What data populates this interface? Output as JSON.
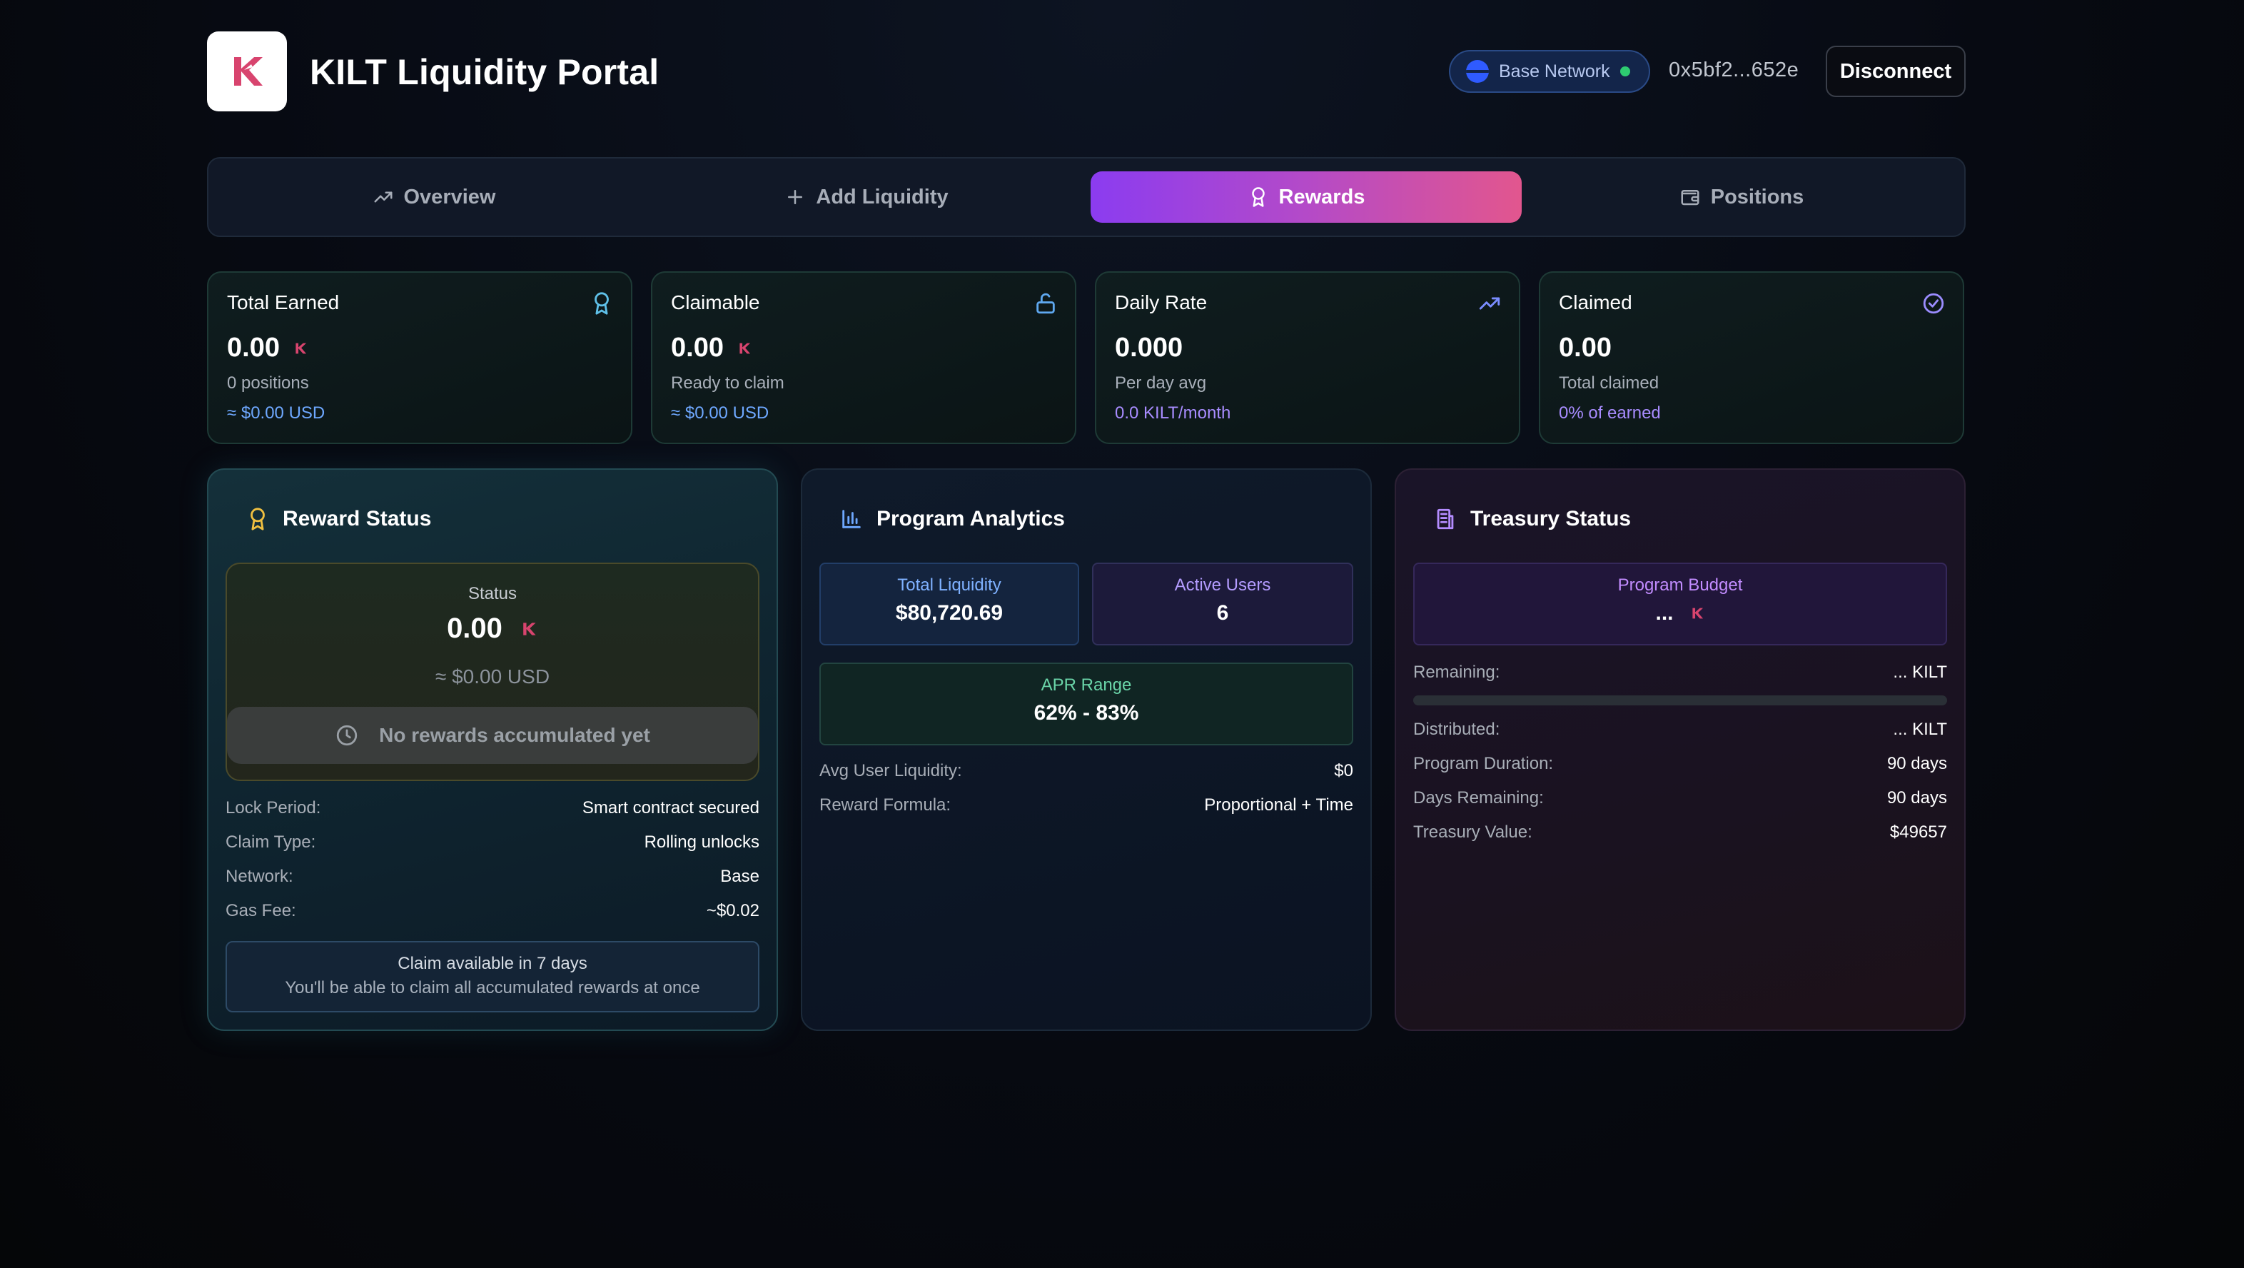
{
  "header": {
    "title": "KILT Liquidity Portal",
    "network_label": "Base Network",
    "wallet_address": "0x5bf2...652e",
    "disconnect_label": "Disconnect"
  },
  "tabs": [
    {
      "label": "Overview",
      "icon": "trending-up-icon",
      "active": false
    },
    {
      "label": "Add Liquidity",
      "icon": "plus-icon",
      "active": false
    },
    {
      "label": "Rewards",
      "icon": "award-icon",
      "active": true
    },
    {
      "label": "Positions",
      "icon": "wallet-icon",
      "active": false
    }
  ],
  "stats": [
    {
      "title": "Total Earned",
      "icon": "award-icon",
      "value": "0.00",
      "sub": "0 positions",
      "usd": "≈ $0.00 USD"
    },
    {
      "title": "Claimable",
      "icon": "unlock-icon",
      "value": "0.00",
      "sub": "Ready to claim",
      "usd": "≈ $0.00 USD"
    },
    {
      "title": "Daily Rate",
      "icon": "trending-up-icon",
      "value": "0.000",
      "sub": "Per day avg",
      "usd": "0.0 KILT/month"
    },
    {
      "title": "Claimed",
      "icon": "check-circle-icon",
      "value": "0.00",
      "sub": "Total claimed",
      "usd": "0% of earned"
    }
  ],
  "reward_status": {
    "title": "Reward Status",
    "status_label": "Status",
    "status_value": "0.00",
    "status_usd": "≈ $0.00 USD",
    "button_label": "No rewards accumulated yet",
    "rows": [
      {
        "k": "Lock Period:",
        "v": "Smart contract secured"
      },
      {
        "k": "Claim Type:",
        "v": "Rolling unlocks"
      },
      {
        "k": "Network:",
        "v": "Base"
      },
      {
        "k": "Gas Fee:",
        "v": "~$0.02"
      }
    ],
    "claim_note_title": "Claim available in 7 days",
    "claim_note_sub": "You'll be able to claim all accumulated rewards at once"
  },
  "analytics": {
    "title": "Program Analytics",
    "total_liquidity_label": "Total Liquidity",
    "total_liquidity_value": "$80,720.69",
    "active_users_label": "Active Users",
    "active_users_value": "6",
    "apr_label": "APR Range",
    "apr_value": "62% - 83%",
    "rows": [
      {
        "k": "Avg User Liquidity:",
        "v": "$0"
      },
      {
        "k": "Reward Formula:",
        "v": "Proportional + Time"
      }
    ]
  },
  "treasury": {
    "title": "Treasury Status",
    "budget_label": "Program Budget",
    "budget_value": "...",
    "remaining_label": "Remaining:",
    "remaining_value": "... KILT",
    "progress_fraction": 0,
    "rows": [
      {
        "k": "Distributed:",
        "v": "... KILT"
      },
      {
        "k": "Program Duration:",
        "v": "90 days"
      },
      {
        "k": "Days Remaining:",
        "v": "90 days"
      },
      {
        "k": "Treasury Value:",
        "v": "$49657"
      }
    ]
  },
  "colors": {
    "accent_gradient_start": "#8b3cf0",
    "accent_gradient_end": "#e2568e",
    "kilt_brand": "#d8446e"
  }
}
